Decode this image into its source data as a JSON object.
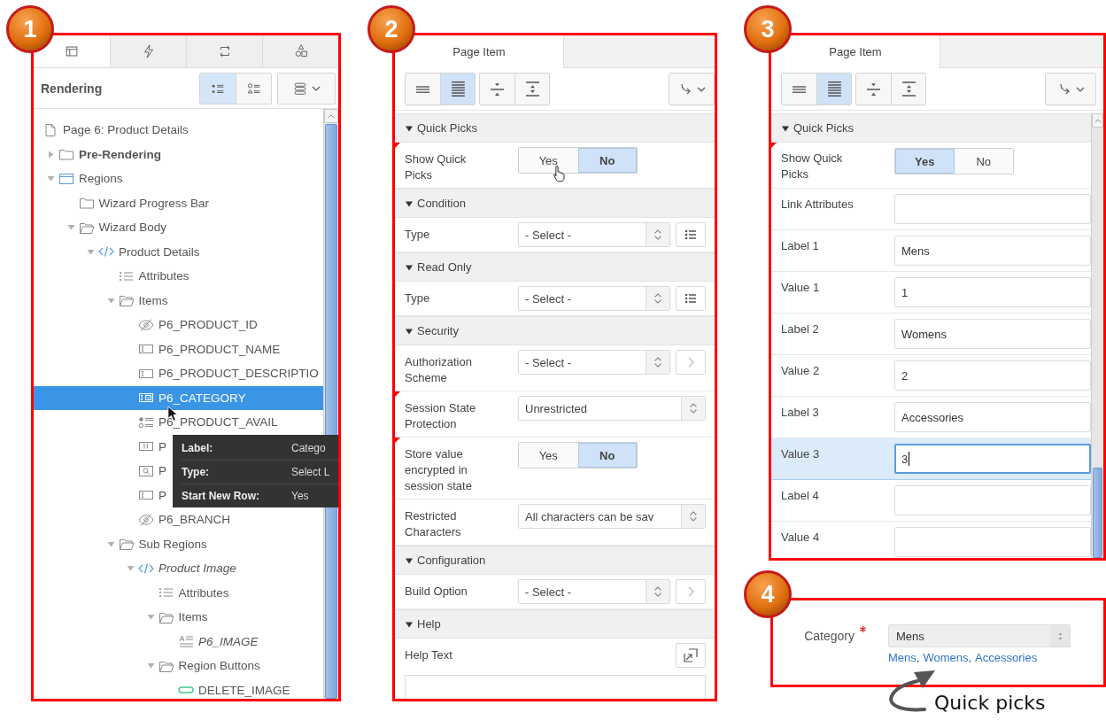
{
  "tree_panel": {
    "badge": "1",
    "tabs": [
      {
        "selected": true
      },
      {
        "selected": false
      },
      {
        "selected": false
      },
      {
        "selected": false
      }
    ],
    "title": "Rendering",
    "view_buttons": [
      {
        "selected": true
      },
      {
        "selected": false
      }
    ],
    "tree": {
      "label": "Page 6: Product Details",
      "kind": "page",
      "selected": false,
      "children": [
        {
          "label": "Pre-Rendering",
          "kind": "folder",
          "expanded": false,
          "has_components": true,
          "selected": false
        },
        {
          "label": "Regions",
          "kind": "region",
          "expanded": true,
          "selected": false,
          "children": [
            {
              "label": "Wizard Progress Bar",
              "kind": "folder",
              "selected": false
            },
            {
              "label": "Wizard Body",
              "kind": "folder-open",
              "expanded": true,
              "selected": false,
              "children": [
                {
                  "label": "Product Details",
                  "kind": "code",
                  "expanded": true,
                  "selected": false,
                  "children": [
                    {
                      "label": "Attributes",
                      "kind": "list",
                      "selected": false
                    },
                    {
                      "label": "Items",
                      "kind": "folder-open",
                      "expanded": true,
                      "selected": false,
                      "children": [
                        {
                          "label": "P6_PRODUCT_ID",
                          "kind": "hidden",
                          "selected": false
                        },
                        {
                          "label": "P6_PRODUCT_NAME",
                          "kind": "text-field",
                          "selected": false
                        },
                        {
                          "label": "P6_PRODUCT_DESCRIPTIO",
                          "kind": "text-field",
                          "selected": false
                        },
                        {
                          "label": "P6_CATEGORY",
                          "kind": "select-list",
                          "selected": true
                        },
                        {
                          "label": "P6_PRODUCT_AVAIL",
                          "kind": "radio-group",
                          "selected": false
                        },
                        {
                          "label": "P",
                          "kind": "number-field",
                          "selected": false
                        },
                        {
                          "label": "P",
                          "kind": "popup-lov",
                          "selected": false
                        },
                        {
                          "label": "P",
                          "kind": "text-field",
                          "selected": false
                        },
                        {
                          "label": "P6_BRANCH",
                          "kind": "hidden",
                          "selected": false
                        }
                      ]
                    },
                    {
                      "label": "Sub Regions",
                      "kind": "folder-open",
                      "expanded": true,
                      "selected": false,
                      "children": [
                        {
                          "label": "Product Image",
                          "kind": "code",
                          "expanded": true,
                          "conditional": true,
                          "selected": false,
                          "children": [
                            {
                              "label": "Attributes",
                              "kind": "list",
                              "selected": false
                            },
                            {
                              "label": "Items",
                              "kind": "folder-open",
                              "expanded": true,
                              "selected": false,
                              "children": [
                                {
                                  "label": "P6_IMAGE",
                                  "kind": "display",
                                  "conditional": true,
                                  "selected": false
                                }
                              ]
                            },
                            {
                              "label": "Region Buttons",
                              "kind": "folder-open",
                              "expanded": true,
                              "selected": false,
                              "children": [
                                {
                                  "label": "DELETE_IMAGE",
                                  "kind": "button",
                                  "selected": false
                                }
                              ]
                            }
                          ]
                        }
                      ]
                    }
                  ]
                }
              ]
            }
          ]
        }
      ]
    },
    "tooltip": {
      "rows": [
        {
          "label": "Label:",
          "value": "Catego"
        },
        {
          "label": "Type:",
          "value": "Select L"
        },
        {
          "label": "Start New Row:",
          "value": "Yes"
        }
      ]
    }
  },
  "property_panels": [
    {
      "badge": "2",
      "tabs": [
        {
          "label": "Page Item",
          "selected": true
        }
      ],
      "toolbar": [
        {
          "selected": false
        },
        {
          "selected": true
        },
        {
          "selected": false
        },
        {
          "selected": false
        }
      ],
      "groups": [
        {
          "title": "Quick Picks",
          "expanded": true,
          "rows": [
            {
              "kind": "toggle",
              "label": "Show Quick Picks",
              "flagged": true,
              "options": [
                {
                  "label": "Yes",
                  "selected": false
                },
                {
                  "label": "No",
                  "selected": true
                }
              ]
            }
          ]
        },
        {
          "title": "Condition",
          "expanded": true,
          "rows": [
            {
              "kind": "select",
              "label": "Type",
              "value": "- Select -",
              "button": {
                "kind": "list"
              },
              "flagged": false
            }
          ]
        },
        {
          "title": "Read Only",
          "expanded": true,
          "rows": [
            {
              "kind": "select",
              "label": "Type",
              "value": "- Select -",
              "button": {
                "kind": "list"
              },
              "flagged": false
            }
          ]
        },
        {
          "title": "Security",
          "expanded": true,
          "rows": [
            {
              "kind": "select",
              "label": "Authorization Scheme",
              "value": "- Select -",
              "button": {
                "kind": "next"
              },
              "flagged": false
            },
            {
              "kind": "select",
              "label": "Session State Protection",
              "value": "Unrestricted",
              "flagged": true
            },
            {
              "kind": "toggle",
              "label": "Store value encrypted in session state",
              "flagged": true,
              "options": [
                {
                  "label": "Yes",
                  "selected": false
                },
                {
                  "label": "No",
                  "selected": true
                }
              ]
            },
            {
              "kind": "select",
              "label": "Restricted Characters",
              "value": "All characters can be sav",
              "flagged": false
            }
          ]
        },
        {
          "title": "Configuration",
          "expanded": true,
          "rows": [
            {
              "kind": "select",
              "label": "Build Option",
              "value": "- Select -",
              "button": {
                "kind": "next"
              },
              "flagged": false
            }
          ]
        },
        {
          "title": "Help",
          "expanded": true,
          "rows": [
            {
              "kind": "textarea",
              "label": "Help Text",
              "flagged": false
            }
          ]
        }
      ]
    },
    {
      "badge": "3",
      "tabs": [
        {
          "label": "Page Item",
          "selected": true
        }
      ],
      "toolbar": [
        {
          "selected": false
        },
        {
          "selected": true
        },
        {
          "selected": false
        },
        {
          "selected": false
        }
      ],
      "groups": [
        {
          "title": "Quick Picks",
          "expanded": true,
          "rows": [
            {
              "kind": "toggle",
              "label": "Show Quick Picks",
              "flagged": true,
              "options": [
                {
                  "label": "Yes",
                  "selected": true
                },
                {
                  "label": "No",
                  "selected": false
                }
              ]
            },
            {
              "kind": "text",
              "label": "Link Attributes",
              "focused": false,
              "flagged": false
            },
            {
              "kind": "text",
              "label": "Label 1",
              "value": "Mens",
              "focused": false,
              "flagged": false
            },
            {
              "kind": "text",
              "label": "Value 1",
              "value": "1",
              "focused": false,
              "flagged": false
            },
            {
              "kind": "text",
              "label": "Label 2",
              "value": "Womens",
              "focused": false,
              "flagged": false
            },
            {
              "kind": "text",
              "label": "Value 2",
              "value": "2",
              "focused": false,
              "flagged": false
            },
            {
              "kind": "text",
              "label": "Label 3",
              "value": "Accessories",
              "focused": false,
              "flagged": false
            },
            {
              "kind": "text",
              "label": "Value 3",
              "value": "3",
              "focused": true,
              "flagged": false
            },
            {
              "kind": "text",
              "label": "Label 4",
              "focused": false,
              "flagged": false
            },
            {
              "kind": "text",
              "label": "Value 4",
              "focused": false,
              "flagged": false
            }
          ]
        }
      ]
    }
  ],
  "form_panel": {
    "badge": "4",
    "label": "Category",
    "required": true,
    "value": "Mens",
    "quick_picks": [
      "Mens",
      "Womens",
      "Accessories"
    ],
    "separator": ","
  },
  "annotation": {
    "text": "Quick picks"
  }
}
